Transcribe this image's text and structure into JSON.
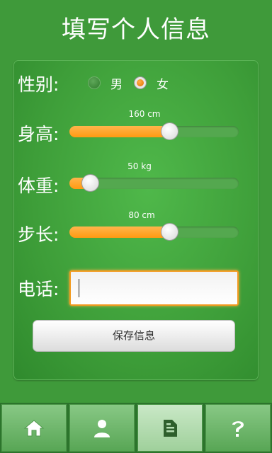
{
  "title": "填写个人信息",
  "gender": {
    "label": "性别:",
    "options": [
      "男",
      "女"
    ],
    "selected": "女"
  },
  "height": {
    "label": "身高:",
    "value_text": "160 cm",
    "fraction": 0.59
  },
  "weight": {
    "label": "体重:",
    "value_text": "50 kg",
    "fraction": 0.12
  },
  "step": {
    "label": "步长:",
    "value_text": "80 cm",
    "fraction": 0.59
  },
  "phone": {
    "label": "电话:",
    "value": ""
  },
  "save_button": "保存信息",
  "tabs": [
    {
      "icon": "home-icon",
      "active": false
    },
    {
      "icon": "person-icon",
      "active": false
    },
    {
      "icon": "document-icon",
      "active": true
    },
    {
      "icon": "help-icon",
      "active": false
    }
  ],
  "colors": {
    "background": "#3f9a3a",
    "accent": "#ff9a12",
    "text": "#ffffff"
  }
}
